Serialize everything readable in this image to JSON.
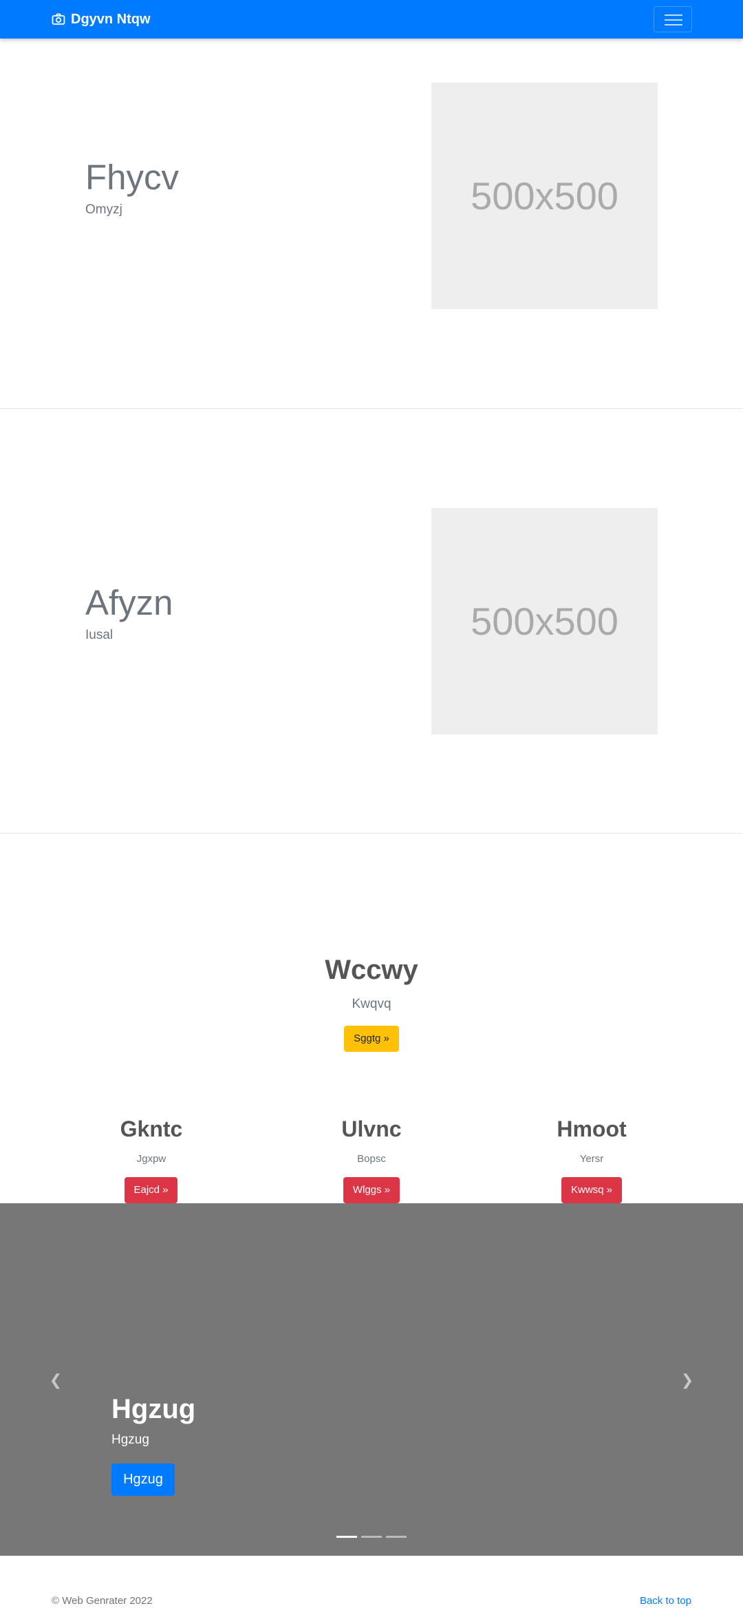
{
  "navbar": {
    "brand": "Dgyvn Ntqw",
    "brand_icon": "camera-icon",
    "toggle_icon": "hamburger-icon",
    "color": "#007bff"
  },
  "features": [
    {
      "heading": "Fhycv",
      "subheading": "Omyzj",
      "image_label": "500x500"
    },
    {
      "heading": "Afyzn",
      "subheading": "Iusal",
      "image_label": "500x500"
    }
  ],
  "promo": {
    "title": "Wccwy",
    "subtitle": "Kwqvq",
    "button": "Sggtg »"
  },
  "columns": [
    {
      "title": "Gkntc",
      "subtitle": "Jgxpw",
      "button": "Eajcd »"
    },
    {
      "title": "Ulvnc",
      "subtitle": "Bopsc",
      "button": "Wlggs »"
    },
    {
      "title": "Hmoot",
      "subtitle": "Yersr",
      "button": "Kwwsq »"
    }
  ],
  "carousel": {
    "caption_title": "Hgzug",
    "caption_text": "Hgzug",
    "caption_button": "Hgzug",
    "prev_icon": "chevron-left-icon",
    "next_icon": "chevron-right-icon",
    "slide_count": 3,
    "active_slide": 1
  },
  "footer": {
    "copyright": "© Web Genrater 2022",
    "back_to_top": "Back to top"
  }
}
